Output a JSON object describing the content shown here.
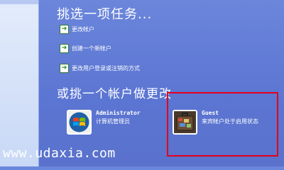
{
  "header": {
    "title": "挑选一项任务..."
  },
  "tasks": [
    {
      "label": "更改帐户",
      "icon": "arrow-right-icon"
    },
    {
      "label": "创建一个新帐户",
      "icon": "arrow-right-icon"
    },
    {
      "label": "更改用户登录或注销的方式",
      "icon": "arrow-right-icon"
    }
  ],
  "accounts_section": {
    "title": "或挑一个帐户做更改"
  },
  "accounts": [
    {
      "name": "Administrator",
      "description": "计算机管理员",
      "icon": "windows-logo-icon"
    },
    {
      "name": "Guest",
      "description": "来宾帐户处于启用状态",
      "icon": "suitcase-icon"
    }
  ],
  "watermark": "www.udaxia.com",
  "colors": {
    "background": "#5b75d2",
    "highlight": "#e3001b",
    "task_icon": "#1a8a1a"
  }
}
